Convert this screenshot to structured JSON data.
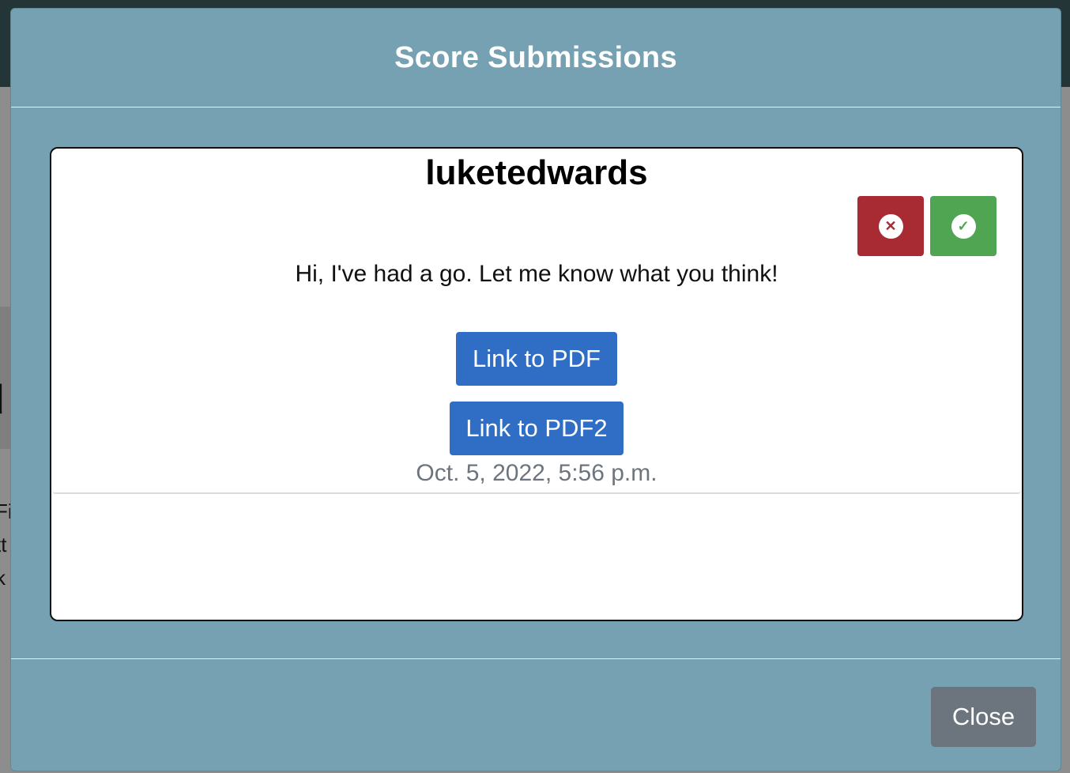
{
  "background": {
    "heading_fragment": "d",
    "lines": [
      "Fi",
      "tt",
      "k"
    ]
  },
  "modal": {
    "title": "Score Submissions",
    "close_label": "Close"
  },
  "submission": {
    "username": "luketedwards",
    "reject_icon": "x-circle-icon",
    "accept_icon": "check-circle-icon",
    "message": "Hi, I've had a go. Let me know what you think!",
    "links": [
      {
        "label": "Link to PDF"
      },
      {
        "label": "Link to PDF2"
      }
    ],
    "timestamp": "Oct. 5, 2022, 5:56 p.m."
  },
  "colors": {
    "modal_bg": "#75a1b2",
    "reject": "#a82a33",
    "accept": "#4fa552",
    "link_button": "#306dc4",
    "close_button": "#6c757d"
  }
}
